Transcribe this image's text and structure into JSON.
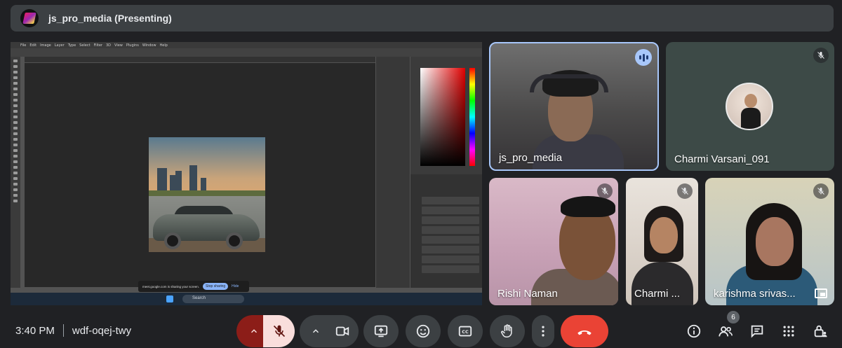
{
  "meeting": {
    "presenter_banner": "js_pro_media (Presenting)",
    "time": "3:40 PM",
    "code": "wdf-oqej-twy",
    "participant_count": "6"
  },
  "shared_screen": {
    "menu_items": [
      "File",
      "Edit",
      "Image",
      "Layer",
      "Type",
      "Select",
      "Filter",
      "3D",
      "View",
      "Plugins",
      "Window",
      "Help"
    ],
    "share_notice": "meet.google.com is sharing your screen.",
    "stop_sharing": "Stop sharing",
    "hide": "Hide",
    "taskbar_search": "Search"
  },
  "participants": [
    {
      "name": "js_pro_media",
      "muted": false,
      "speaking": true
    },
    {
      "name": "Charmi Varsani_091",
      "muted": true
    },
    {
      "name": "Rishi Naman",
      "muted": true
    },
    {
      "name": "Charmi ...",
      "muted": true
    },
    {
      "name": "karishma srivas...",
      "muted": true
    }
  ],
  "controls": {
    "mic": {
      "state": "muted",
      "accent": "#f9dedc",
      "bg": "#8c1d18"
    },
    "leave_color": "#ea4335"
  },
  "colors": {
    "bg": "#202124",
    "surface": "#3c4043",
    "active_border": "#a8c7fa"
  }
}
